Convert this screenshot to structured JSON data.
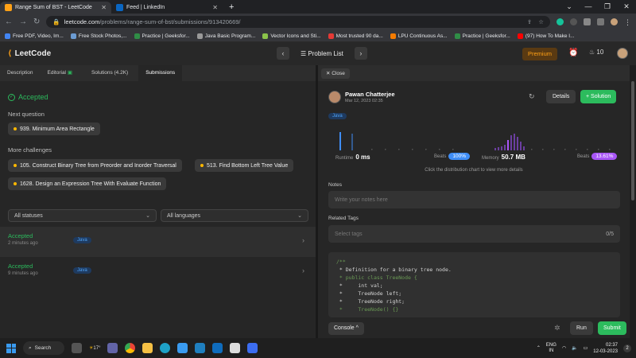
{
  "browser": {
    "tabs": [
      {
        "title": "Range Sum of BST - LeetCode",
        "active": true
      },
      {
        "title": "Feed | LinkedIn",
        "active": false
      }
    ],
    "url_host": "leetcode.com",
    "url_path": "/problems/range-sum-of-bst/submissions/913420669/",
    "bookmarks": [
      "Free PDF, Video, Im...",
      "Free Stock Photos,...",
      "Practice | Geeksfor...",
      "Java Basic Program...",
      "Vector Icons and Sti...",
      "Most trusted 90 da...",
      "LPU Continuous As...",
      "Practice | Geeksfor...",
      "(97) How To Make I..."
    ]
  },
  "header": {
    "logo": "LeetCode",
    "problem_list": "Problem List",
    "premium": "Premium",
    "streak": "10"
  },
  "left": {
    "tabs": [
      "Description",
      "Editorial",
      "Solutions (4.2K)",
      "Submissions"
    ],
    "status": "Accepted",
    "next_question_label": "Next question",
    "next_question": "939. Minimum Area Rectangle",
    "more_challenges_label": "More challenges",
    "challenges": [
      "105. Construct Binary Tree from Preorder and Inorder Traversal",
      "513. Find Bottom Left Tree Value",
      "1628. Design an Expression Tree With Evaluate Function"
    ],
    "filter_status": "All statuses",
    "filter_language": "All languages",
    "submissions": [
      {
        "status": "Accepted",
        "time": "2 minutes ago",
        "lang": "Java"
      },
      {
        "status": "Accepted",
        "time": "9 minutes ago",
        "lang": "Java"
      }
    ]
  },
  "right": {
    "close": "Close",
    "user_name": "Pawan Chatterjee",
    "date": "Mar 12, 2023 02:35",
    "details": "Details",
    "solution": "+ Solution",
    "lang": "Java",
    "runtime_label": "Runtime",
    "runtime_value": "0 ms",
    "runtime_beats_label": "Beats",
    "runtime_beats": "100%",
    "memory_label": "Memory",
    "memory_value": "50.7 MB",
    "memory_beats_label": "Beats",
    "memory_beats": "13.61%",
    "hint": "Click the distribution chart to view more details",
    "notes_label": "Notes",
    "notes_placeholder": "Write your notes here",
    "tags_label": "Related Tags",
    "tags_placeholder": "Select tags",
    "tags_count": "0/5",
    "code_lines": [
      "/**",
      " * Definition for a binary tree node.",
      " * public class TreeNode {",
      " *     int val;",
      " *     TreeNode left;",
      " *     TreeNode right;",
      " *     TreeNode() {}"
    ],
    "console": "Console ^",
    "run": "Run",
    "submit": "Submit"
  },
  "taskbar": {
    "search": "Search",
    "weather": "17°",
    "lang_top": "ENG",
    "lang_bottom": "IN",
    "time": "02:37",
    "date": "12-03-2023"
  }
}
